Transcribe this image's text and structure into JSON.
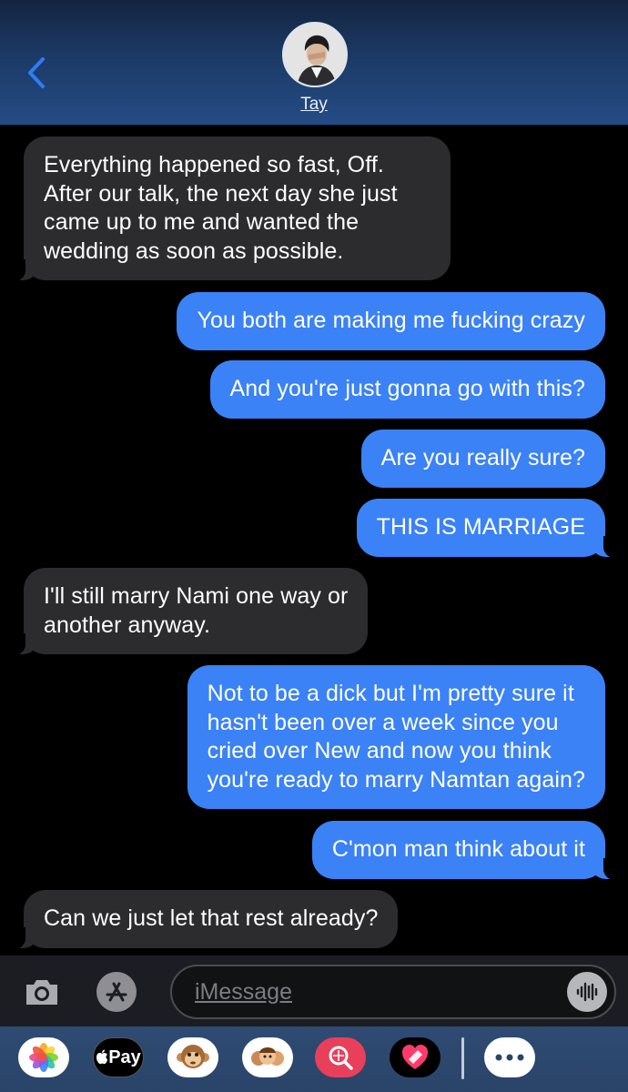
{
  "header": {
    "contact_name": "Tay",
    "back_icon": "chevron-left-icon"
  },
  "messages": [
    {
      "from": "them",
      "text": "Everything happened so fast, Off.\nAfter our talk, the next day she just\ncame up to me and wanted the\nwedding as soon as possible."
    },
    {
      "from": "me",
      "text": "You both are making me fucking crazy"
    },
    {
      "from": "me",
      "text": "And you're just gonna go with this?"
    },
    {
      "from": "me",
      "text": "Are you really sure?"
    },
    {
      "from": "me",
      "text": "THIS IS MARRIAGE"
    },
    {
      "from": "them",
      "text": "I'll still marry Nami one way or\nanother anyway."
    },
    {
      "from": "me",
      "text": "Not to be a dick but I'm pretty sure it\nhasn't been over a week since you\ncried over New and now you think\nyou're ready to marry Namtan again?"
    },
    {
      "from": "me",
      "text": "C'mon man think about it"
    },
    {
      "from": "them",
      "text": "Can we just let that rest already?"
    }
  ],
  "composer": {
    "placeholder": "iMessage",
    "camera_icon": "camera-icon",
    "apps_icon": "app-store-icon",
    "audio_icon": "waveform-icon"
  },
  "app_drawer": {
    "items": [
      "photos-icon",
      "apple-pay-icon",
      "monkey-memoji-icon",
      "memoji-group-icon",
      "image-search-icon",
      "digital-touch-icon",
      "more-icon"
    ],
    "pay_label": "Pay"
  },
  "colors": {
    "sent_bubble": "#3b82f6",
    "received_bubble": "#2c2c2e",
    "accent": "#2f7cf6"
  }
}
